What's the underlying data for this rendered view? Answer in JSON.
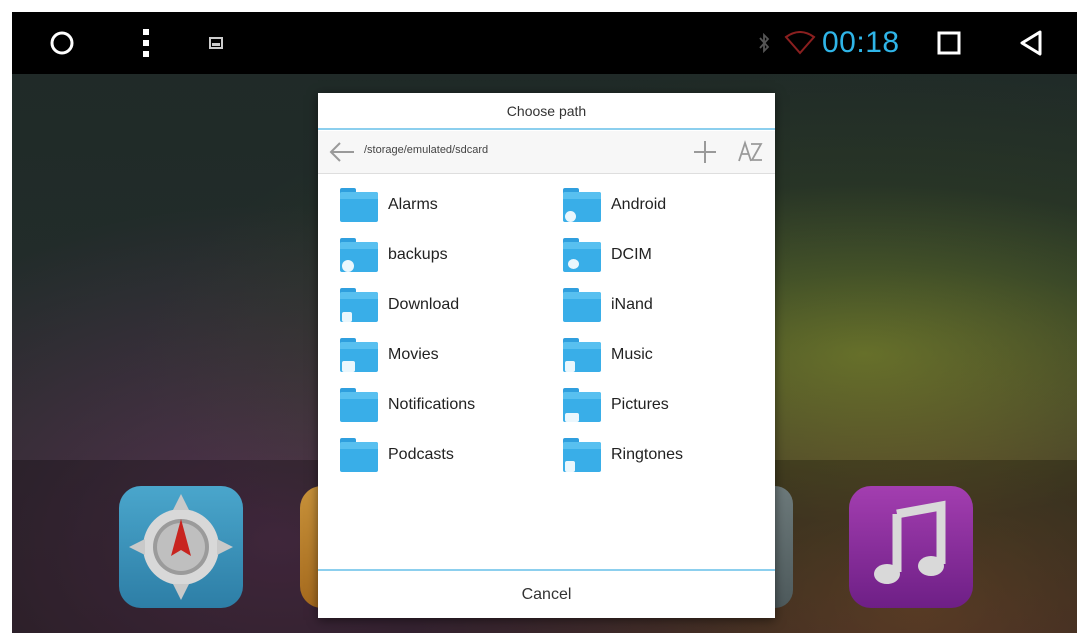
{
  "status_bar": {
    "time": "00:18",
    "icons": [
      "home-circle-icon",
      "more-vertical-icon",
      "image-notification-icon",
      "bluetooth-icon",
      "wifi-icon",
      "recents-square-icon",
      "back-triangle-icon"
    ],
    "time_color": "#2fb5e8"
  },
  "dialog": {
    "title": "Choose path",
    "path": "/storage/emulated/sdcard",
    "actions": [
      "back-arrow-icon",
      "add-folder-icon",
      "sort-az-icon"
    ],
    "folders": [
      {
        "label": "Alarms",
        "icon": "folder-icon"
      },
      {
        "label": "Android",
        "icon": "folder-settings-icon"
      },
      {
        "label": "backups",
        "icon": "folder-backup-icon"
      },
      {
        "label": "DCIM",
        "icon": "folder-camera-icon"
      },
      {
        "label": "Download",
        "icon": "folder-download-icon"
      },
      {
        "label": "iNand",
        "icon": "folder-icon"
      },
      {
        "label": "Movies",
        "icon": "folder-video-icon"
      },
      {
        "label": "Music",
        "icon": "folder-music-icon"
      },
      {
        "label": "Notifications",
        "icon": "folder-icon"
      },
      {
        "label": "Pictures",
        "icon": "folder-image-icon"
      },
      {
        "label": "Podcasts",
        "icon": "folder-icon"
      },
      {
        "label": "Ringtones",
        "icon": "folder-music-icon"
      }
    ],
    "cancel_label": "Cancel",
    "accent_color": "#8ccfee",
    "folder_color": "#39aee8"
  },
  "dock_apps": [
    {
      "name": "navigation-app",
      "icon": "compass-icon"
    },
    {
      "name": "app-partial-left",
      "icon": "app-icon"
    },
    {
      "name": "app-partial-right",
      "icon": "app-icon"
    },
    {
      "name": "music-app",
      "icon": "music-note-icon"
    }
  ]
}
